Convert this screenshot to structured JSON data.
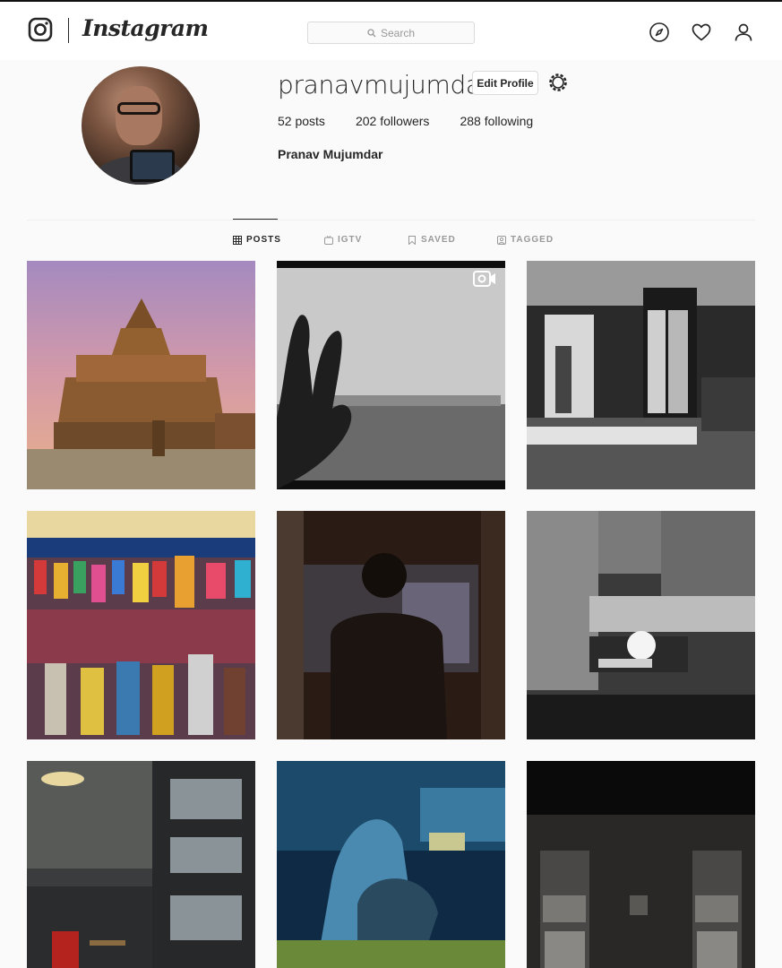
{
  "nav": {
    "logo_text": "Instagram",
    "search_placeholder": "Search"
  },
  "profile": {
    "username": "pranavmujumdar",
    "edit_profile_label": "Edit Profile",
    "stats": [
      {
        "count": "52",
        "label": "posts"
      },
      {
        "count": "202",
        "label": "followers"
      },
      {
        "count": "288",
        "label": "following"
      }
    ],
    "full_name": "Pranav Mujumdar"
  },
  "tabs": [
    {
      "label": "POSTS",
      "icon": "grid-icon",
      "active": true
    },
    {
      "label": "IGTV",
      "icon": "tv-icon",
      "active": false
    },
    {
      "label": "SAVED",
      "icon": "bookmark-icon",
      "active": false
    },
    {
      "label": "TAGGED",
      "icon": "tag-icon",
      "active": false
    }
  ],
  "posts": [
    {
      "subject": "temple",
      "type": "photo"
    },
    {
      "subject": "hand-sea-skyline",
      "type": "video"
    },
    {
      "subject": "coca-cola-shop",
      "type": "photo"
    },
    {
      "subject": "lantern-market",
      "type": "photo"
    },
    {
      "subject": "man-in-bus",
      "type": "photo"
    },
    {
      "subject": "festival-lights-bw",
      "type": "photo"
    },
    {
      "subject": "cafe-signage",
      "type": "photo"
    },
    {
      "subject": "street-painting",
      "type": "photo"
    },
    {
      "subject": "dark-doors",
      "type": "photo"
    }
  ]
}
